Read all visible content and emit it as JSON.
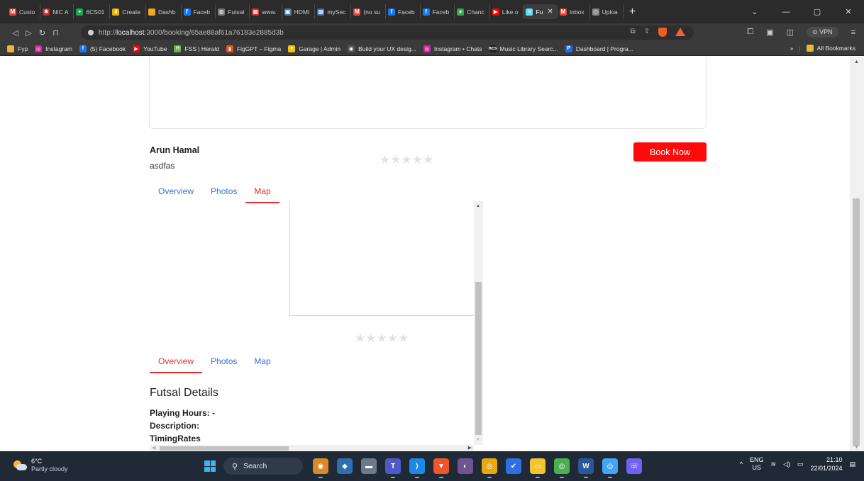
{
  "browser": {
    "tabs": [
      {
        "label": "Custo",
        "icon": "gmail-icon",
        "color": "#ea4335",
        "glyph": "M"
      },
      {
        "label": "NIC A",
        "icon": "nic-asia-icon",
        "color": "#c62828",
        "glyph": "✱"
      },
      {
        "label": "6CS01",
        "icon": "sheets-icon",
        "color": "#1ea362",
        "glyph": "+"
      },
      {
        "label": "Create",
        "icon": "slack-icon",
        "color": "#e8b400",
        "glyph": "#"
      },
      {
        "label": "Dashb",
        "icon": "dashboard-icon",
        "color": "#f4a21f",
        "glyph": "◌"
      },
      {
        "label": "Faceb",
        "icon": "facebook-icon",
        "color": "#1877f2",
        "glyph": "f"
      },
      {
        "label": "Futsal",
        "icon": "globe-icon",
        "color": "#777777",
        "glyph": "◍"
      },
      {
        "label": "www.",
        "icon": "grid-site-icon",
        "color": "#d32f2f",
        "glyph": "▦"
      },
      {
        "label": "HDMI",
        "icon": "hdmi-icon",
        "color": "#5a7a9a",
        "glyph": "▣"
      },
      {
        "label": "mySec",
        "icon": "mysecond-icon",
        "color": "#4b62c9",
        "glyph": "▩"
      },
      {
        "label": "(no su",
        "icon": "gmail-icon",
        "color": "#ea4335",
        "glyph": "M"
      },
      {
        "label": "Faceb",
        "icon": "facebook-icon",
        "color": "#1877f2",
        "glyph": "f"
      },
      {
        "label": "Faceb",
        "icon": "facebook-icon",
        "color": "#1877f2",
        "glyph": "f"
      },
      {
        "label": "Chanc",
        "icon": "maps-pin-icon",
        "color": "#34a853",
        "glyph": "♦"
      },
      {
        "label": "Like o",
        "icon": "youtube-icon",
        "color": "#ff0000",
        "glyph": "▶"
      },
      {
        "label": "Fu",
        "icon": "react-icon",
        "color": "#61dafb",
        "glyph": "⚛",
        "active": true
      },
      {
        "label": "Inbox",
        "icon": "gmail-icon",
        "color": "#ea4335",
        "glyph": "M"
      },
      {
        "label": "Uploa",
        "icon": "upload-icon",
        "color": "#8a8a8a",
        "glyph": "◇"
      }
    ],
    "url_prefix": "http://",
    "url_host": "localhost",
    "url_path": ":3000/booking/65ae88af61a76183e2885d3b",
    "vpn_label": "⊙ VPN",
    "bookmarks": [
      {
        "label": "Fyp",
        "icon": "folder-icon",
        "color": "#e9b53a",
        "glyph": ""
      },
      {
        "label": "Instagram",
        "icon": "instagram-icon",
        "color": "#d6249f",
        "glyph": "◎"
      },
      {
        "label": "(5) Facebook",
        "icon": "facebook-icon",
        "color": "#1877f2",
        "glyph": "f"
      },
      {
        "label": "YouTube",
        "icon": "youtube-icon",
        "color": "#ff0000",
        "glyph": "▶"
      },
      {
        "label": "FSS | Herald",
        "icon": "herald-icon",
        "color": "#6ab04c",
        "glyph": "H"
      },
      {
        "label": "FigGPT – Figma",
        "icon": "figma-icon",
        "color": "#f24e1e",
        "glyph": "▮"
      },
      {
        "label": "Garage | Admin",
        "icon": "garage-icon",
        "color": "#f1c40f",
        "glyph": "♥"
      },
      {
        "label": "Build your UX desig...",
        "icon": "openai-icon",
        "color": "#555555",
        "glyph": "◉"
      },
      {
        "label": "Instagram • Chats",
        "icon": "instagram-icon",
        "color": "#d6249f",
        "glyph": "◎"
      },
      {
        "label": "Music Library Searc...",
        "icon": "ncs-icon",
        "color": "#222222",
        "glyph": "ncs"
      },
      {
        "label": "Dashboard | Progra...",
        "icon": "programiz-icon",
        "color": "#1f6feb",
        "glyph": "P"
      }
    ],
    "bookmarks_overflow": "»",
    "all_bookmarks": "All Bookmarks"
  },
  "page": {
    "owner_name": "Arun Hamal",
    "owner_description": "asdfas",
    "rating_stars": "★★★★★",
    "book_button": "Book Now",
    "tabs_top": [
      {
        "label": "Overview",
        "active": false
      },
      {
        "label": "Photos",
        "active": false
      },
      {
        "label": "Map",
        "active": true
      }
    ],
    "tabs_inner": [
      {
        "label": "Overview",
        "active": true
      },
      {
        "label": "Photos",
        "active": false
      },
      {
        "label": "Map",
        "active": false
      }
    ],
    "section_title": "Futsal Details",
    "playing_hours": "Playing Hours: -",
    "description_label": "Description:",
    "timing_rates_label": "TimingRates",
    "accent_color": "#ff0a0a",
    "link_color": "#3b6fd8"
  },
  "taskbar": {
    "temperature": "6°C",
    "weather": "Partly cloudy",
    "search_label": "Search",
    "lang_top": "ENG",
    "lang_bottom": "US",
    "time": "21:10",
    "date": "22/01/2024",
    "apps": [
      {
        "icon": "chrome-canary-icon",
        "color": "#d88a2a",
        "glyph": "◉",
        "open": true
      },
      {
        "icon": "app-rocket-icon",
        "color": "#2e6fb0",
        "glyph": "◆",
        "open": false
      },
      {
        "icon": "taskview-icon",
        "color": "#6c7a89",
        "glyph": "▬",
        "open": false
      },
      {
        "icon": "teams-icon",
        "color": "#5059c9",
        "glyph": "T",
        "open": true
      },
      {
        "icon": "vscode-icon",
        "color": "#1e88e5",
        "glyph": "⟩",
        "open": true
      },
      {
        "icon": "brave-icon",
        "color": "#f0542c",
        "glyph": "▼",
        "open": true
      },
      {
        "icon": "github-desktop-icon",
        "color": "#6e5494",
        "glyph": "◐",
        "open": false
      },
      {
        "icon": "chrome-icon",
        "color": "#e8a90c",
        "glyph": "◎",
        "open": true
      },
      {
        "icon": "todo-icon",
        "color": "#2f6fe0",
        "glyph": "✔",
        "open": false
      },
      {
        "icon": "file-explorer-icon",
        "color": "#f4c430",
        "glyph": "▭",
        "open": true
      },
      {
        "icon": "chrome-profile-icon",
        "color": "#4caf50",
        "glyph": "◎",
        "open": true
      },
      {
        "icon": "word-icon",
        "color": "#2b579a",
        "glyph": "W",
        "open": true
      },
      {
        "icon": "chrome-beta-icon",
        "color": "#42a5f5",
        "glyph": "◎",
        "open": true
      },
      {
        "icon": "viber-icon",
        "color": "#7360f2",
        "glyph": "☏",
        "open": false
      }
    ]
  }
}
